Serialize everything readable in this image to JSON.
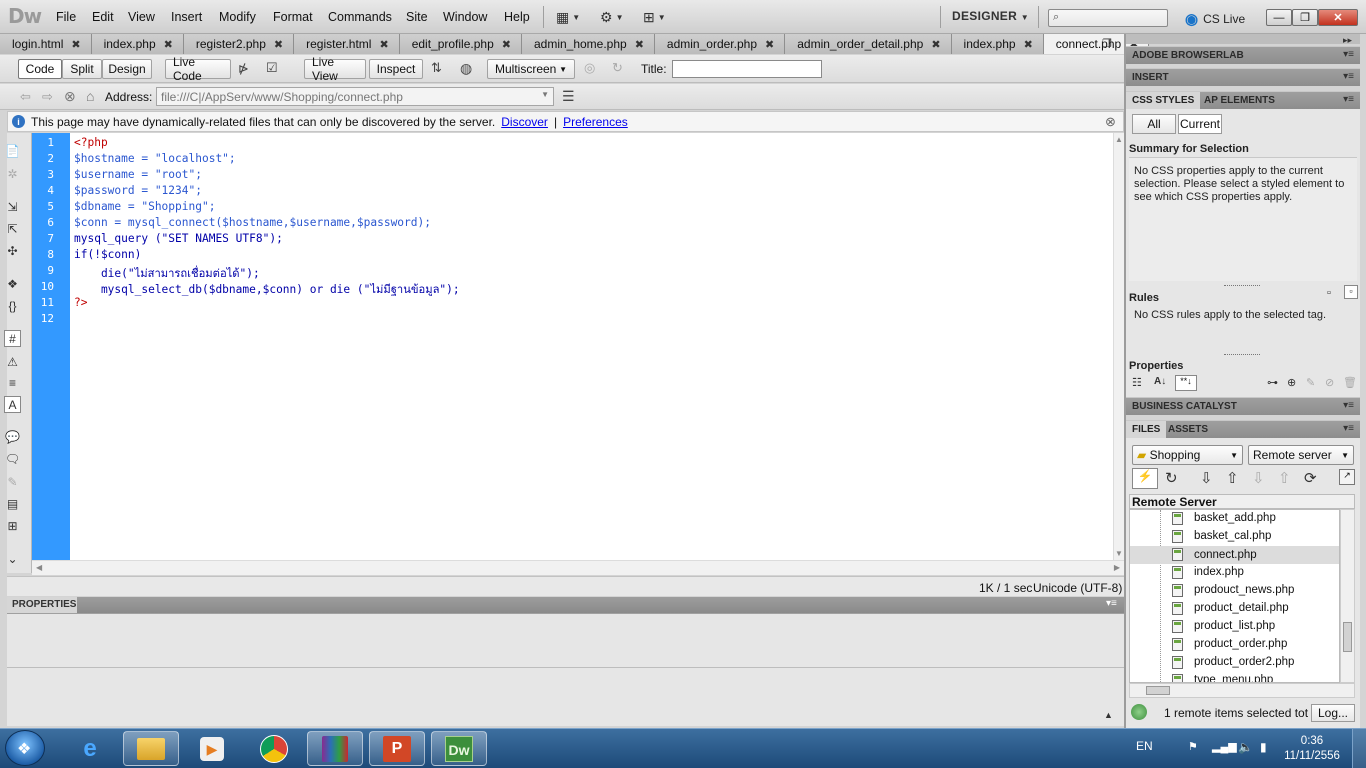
{
  "app": {
    "logo": "Dw",
    "workspace": "DESIGNER",
    "cs_live": "CS Live"
  },
  "menu": [
    "File",
    "Edit",
    "View",
    "Insert",
    "Modify",
    "Format",
    "Commands",
    "Site",
    "Window",
    "Help"
  ],
  "tabs": [
    "login.html",
    "index.php",
    "register2.php",
    "register.html",
    "edit_profile.php",
    "admin_home.php",
    "admin_order.php",
    "admin_order_detail.php",
    "index.php",
    "connect.php"
  ],
  "active_tab": "connect.php",
  "doc_toolbar": {
    "code": "Code",
    "split": "Split",
    "design": "Design",
    "live_code": "Live Code",
    "live_view": "Live View",
    "inspect": "Inspect",
    "multiscreen": "Multiscreen",
    "title_label": "Title:",
    "title_value": ""
  },
  "address": {
    "label": "Address:",
    "value": "file:///C|/AppServ/www/Shopping/connect.php"
  },
  "info": {
    "message": "This page may have dynamically-related files that can only be discovered by the server.",
    "discover": "Discover",
    "separator": "|",
    "preferences": "Preferences"
  },
  "code_lines": [
    "<?php",
    "$hostname = \"localhost\";",
    "$username = \"root\";",
    "$password = \"1234\";",
    "$dbname = \"Shopping\";",
    "$conn = mysql_connect($hostname,$username,$password);",
    "mysql_query (\"SET NAMES UTF8\");",
    "if(!$conn)",
    "    die(\"ไม่สามารถเชื่อมต่อได้\");",
    "    mysql_select_db($dbname,$conn) or die (\"ไม่มีฐานข้อมูล\");",
    "?>",
    ""
  ],
  "status": {
    "size_time": "1K / 1 sec",
    "encoding": "Unicode (UTF-8)"
  },
  "properties_panel": {
    "title": "PROPERTIES"
  },
  "right_panels": {
    "browserlab": "ADOBE BROWSERLAB",
    "insert": "INSERT",
    "css_styles": "CSS STYLES",
    "ap_elements": "AP ELEMENTS",
    "all": "All",
    "current": "Current",
    "summary_label": "Summary for Selection",
    "summary_text": "No CSS properties apply to the current selection.  Please select a styled element to see which CSS properties apply.",
    "rules_label": "Rules",
    "rules_text": "No CSS rules apply to the selected tag.",
    "properties_label": "Properties",
    "business_catalyst": "BUSINESS CATALYST",
    "files": "FILES",
    "assets": "ASSETS",
    "site": "Shopping",
    "server_view": "Remote server",
    "remote_header": "Remote Server",
    "file_items": [
      "basket_add.php",
      "basket_cal.php",
      "connect.php",
      "index.php",
      "prodouct_news.php",
      "product_detail.php",
      "product_list.php",
      "product_order.php",
      "product_order2.php",
      "type_menu.php"
    ],
    "selected_file": "connect.php",
    "files_status": "1 remote items selected tot",
    "log_button": "Log..."
  },
  "taskbar": {
    "lang": "EN",
    "time": "0:36",
    "date": "11/11/2556"
  },
  "colors": {
    "gutter": "#3399ff",
    "php_tag": "#c00000",
    "string": "#c00000",
    "keyword": "#0000a8",
    "variable": "#2b57d0"
  }
}
